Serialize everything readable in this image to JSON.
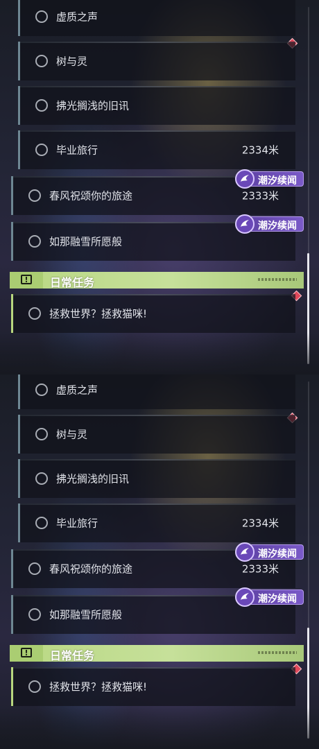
{
  "colors": {
    "story_accent": "#6e8793",
    "daily_accent": "#b8d77e",
    "badge_purple": "#6a48b8",
    "marker_red": "#e0485a"
  },
  "quests": [
    {
      "title": "虚质之声",
      "distance": ""
    },
    {
      "title": "树与灵",
      "distance": ""
    },
    {
      "title": "拂光搁浅的旧讯",
      "distance": ""
    },
    {
      "title": "毕业旅行",
      "distance": "2334米"
    },
    {
      "title": "春风祝颂你的旅途",
      "distance": "2333米",
      "badge": "潮汐续闻"
    },
    {
      "title": "如那融雪所愿般",
      "distance": "",
      "badge": "潮汐续闻"
    }
  ],
  "daily_section": {
    "title": "日常任务",
    "icon": "alert-icon",
    "glyph": "!"
  },
  "daily_quests": [
    {
      "title": "拯救世界？拯救猫咪!"
    }
  ]
}
